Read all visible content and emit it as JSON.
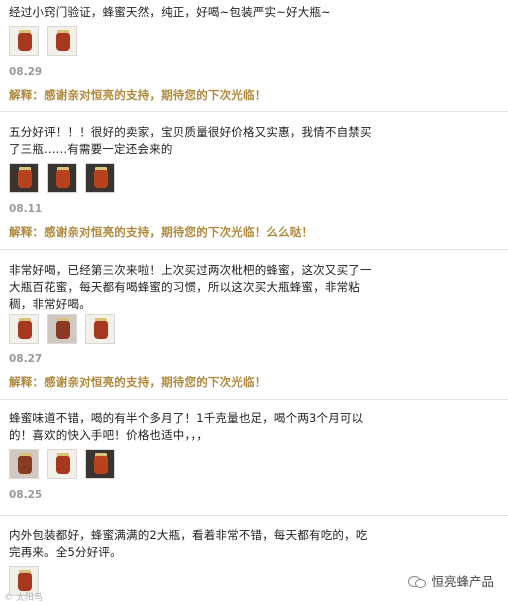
{
  "reviews": [
    {
      "text": "经过小窍门验证，蜂蜜天然，纯正，好喝~包装严实~好大瓶~",
      "date": "08.29",
      "reply": "解释：感谢亲对恒亮的支持，期待您的下次光临！",
      "thumbs": [
        "honey-jar-photo",
        "honey-jar-photo"
      ]
    },
    {
      "text": "五分好评！！！很好的卖家，宝贝质量很好价格又实惠，我情不自禁买了三瓶......有需要一定还会来的",
      "date": "08.11",
      "reply": "解释：感谢亲对恒亮的支持，期待您的下次光临！么么哒！",
      "thumbs": [
        "honey-jar-photo",
        "honey-jar-photo",
        "honey-jar-photo"
      ]
    },
    {
      "text": "非常好喝，已经第三次来啦！上次买过两次枇杷的蜂蜜，这次又买了一大瓶百花蜜，每天都有喝蜂蜜的习惯，所以这次买大瓶蜂蜜，非常粘稠，非常好喝。",
      "date": "08.27",
      "reply": "解释：感谢亲对恒亮的支持，期待您的下次光临！",
      "thumbs": [
        "honey-jar-photo",
        "honey-jar-photo",
        "honey-jar-photo"
      ]
    },
    {
      "text": "蜂蜜味道不错，喝的有半个多月了！1千克量也足，喝个两3个月可以的！喜欢的快入手吧！价格也适中，，，",
      "date": "08.25",
      "reply": "",
      "thumbs": [
        "honey-jar-photo",
        "honey-jar-photo",
        "honey-jar-photo"
      ]
    },
    {
      "text": "内外包装都好，蜂蜜满满的2大瓶，看着非常不错，每天都有吃的，吃完再来。全5分好评。",
      "date": "",
      "reply": "",
      "thumbs": [
        "honey-jar-photo"
      ]
    }
  ],
  "watermark": {
    "label": "恒亮蜂产品",
    "icon": "wechat-icon"
  },
  "corner_mark": "© 太阳鸟"
}
